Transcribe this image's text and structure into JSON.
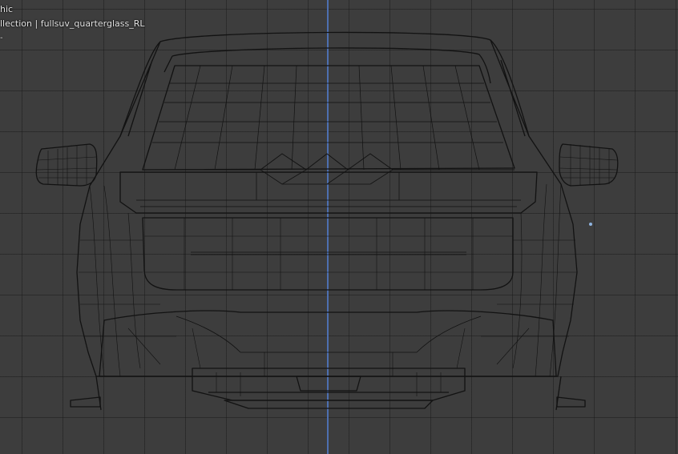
{
  "viewport": {
    "overlay": {
      "view_name": "hic",
      "collection_info": "llection | fullsuv_quarterglass_RL",
      "extra": "-"
    },
    "colors": {
      "background": "#3d3d3d",
      "grid": "#2e2e2e",
      "axis": "#4d6fb0",
      "wire": "#111111",
      "origin": "#8fb4e0"
    },
    "object": "fullsuv_quarterglass_RL"
  }
}
